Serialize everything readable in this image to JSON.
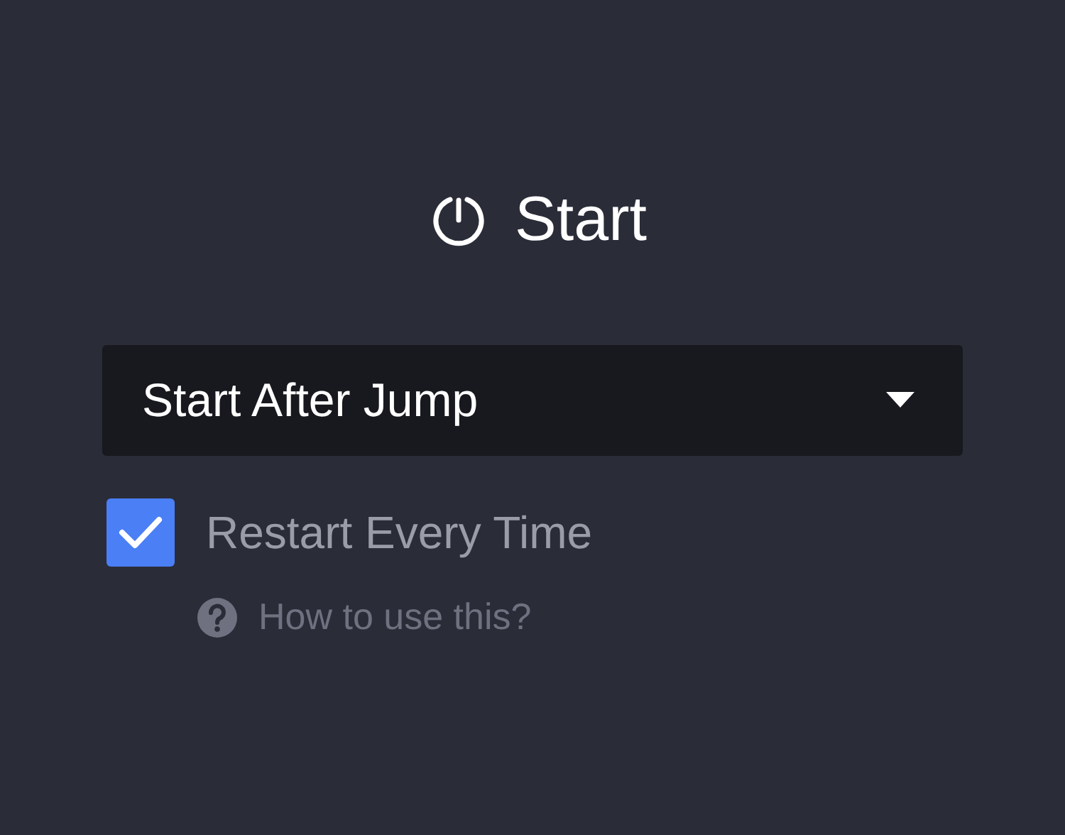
{
  "title": "Start",
  "dropdown": {
    "value": "Start After Jump"
  },
  "checkbox": {
    "label": "Restart Every Time",
    "checked": true
  },
  "help_link": {
    "label": "How to use this?"
  }
}
